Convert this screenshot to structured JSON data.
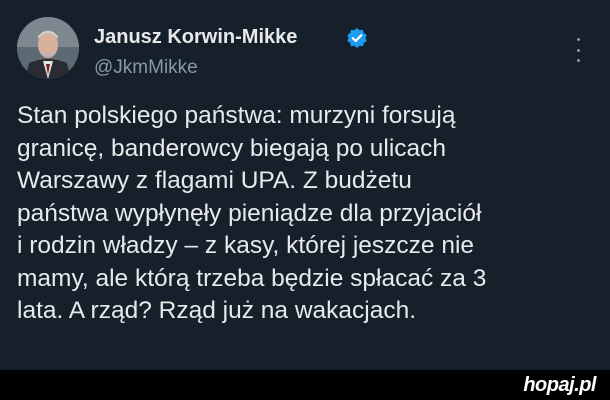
{
  "tweet": {
    "author": {
      "display_name": "Janusz Korwin-Mikke",
      "handle": "@JkmMikke",
      "verified": true,
      "verified_color": "#1d9bf0"
    },
    "text_lines": [
      "Stan polskiego państwa: murzyni forsują",
      "granicę, banderowcy biegają po ulicach",
      "Warszawy z flagami UPA. Z budżetu",
      "państwa wypłynęły pieniądze dla przyjaciół",
      "i rodzin władzy – z kasy, której jeszcze nie",
      "mamy, ale którą trzeba będzie spłacać za 3",
      "lata. A rząd? Rząd już na wakacjach."
    ],
    "more_icon": "more-vertical-icon"
  },
  "theme": {
    "background": "#15202b",
    "text": "#e7e9ea",
    "secondary_text": "#8b98a5",
    "footer_background": "#000000"
  },
  "watermark": {
    "text": "hopaj.pl"
  }
}
